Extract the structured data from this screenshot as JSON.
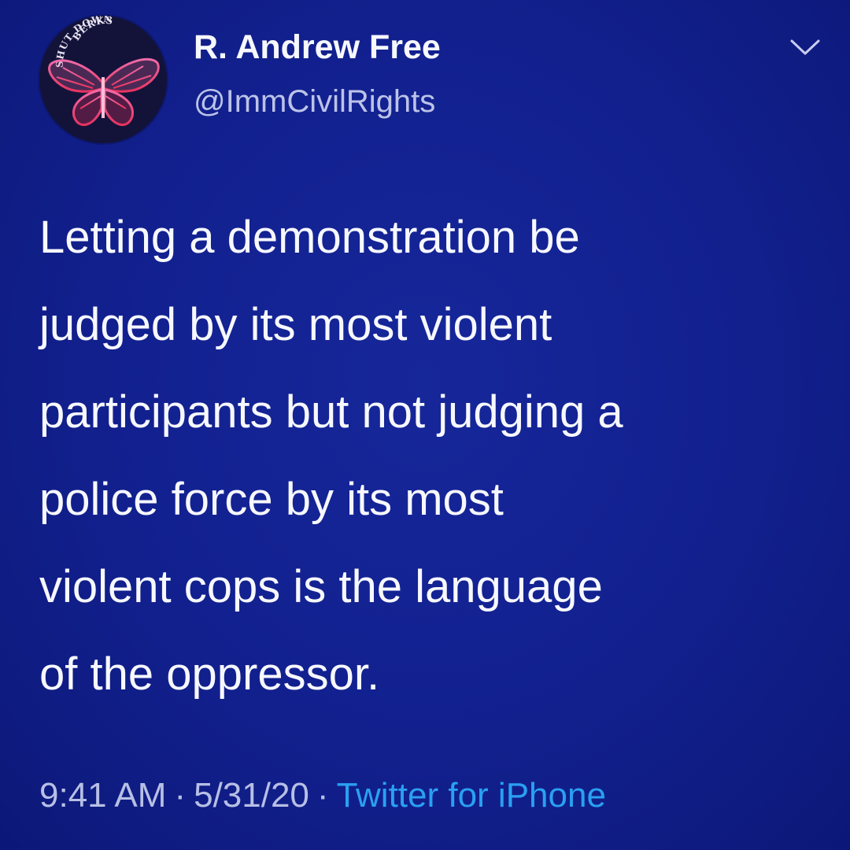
{
  "user": {
    "display_name": "R. Andrew Free",
    "handle": "@ImmCivilRights",
    "avatar": {
      "text_top": "SHUT DOWN",
      "text_bottom": "BERKS",
      "icon": "butterfly-icon"
    }
  },
  "menu_icon": "chevron-down-icon",
  "tweet": {
    "lines": [
      "Letting a demonstration be",
      "judged by its most violent",
      "participants but not judging a",
      "police force by its most",
      "violent cops is the language",
      "of the oppressor."
    ]
  },
  "meta": {
    "time": "9:41 AM",
    "separator": "·",
    "date": "5/31/20",
    "source": "Twitter for iPhone"
  },
  "colors": {
    "background": "#12208e",
    "text": "#f7f8fd",
    "secondary_text": "#b7bfe5",
    "link": "#2aa0f2",
    "avatar_butterfly": "#ef4f8f"
  }
}
